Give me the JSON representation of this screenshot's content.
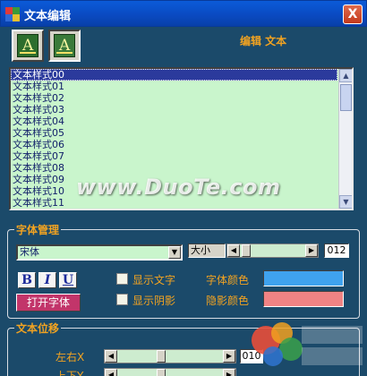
{
  "window": {
    "title": "文本编辑",
    "close_glyph": "X"
  },
  "toolbar": {
    "btn1_icon": "text-style-icon",
    "btn2_icon": "text-style-pressed-icon",
    "glyph": "A"
  },
  "header": {
    "label": "编辑 文本"
  },
  "text_styles": {
    "items": [
      "文本样式00",
      "文本样式01",
      "文本样式02",
      "文本样式03",
      "文本样式04",
      "文本样式05",
      "文本样式06",
      "文本样式07",
      "文本样式08",
      "文本样式09",
      "文本样式10",
      "文本样式11"
    ],
    "selected_index": 0
  },
  "watermark": {
    "text": "www.DuoTe.com"
  },
  "font_group": {
    "title": "字体管理",
    "font_name": "宋体",
    "size_label": "大小",
    "size_value": "012",
    "bold": "B",
    "italic": "I",
    "underline": "U",
    "open_font": "打开字体",
    "show_text": "显示文字",
    "show_shadow": "显示阴影",
    "font_color_label": "字体颜色",
    "shadow_color_label": "隐影颜色",
    "font_color": "#3fa2ee",
    "shadow_color": "#f08384"
  },
  "offset_group": {
    "title": "文本位移",
    "lr_label": "左右X",
    "lr_value": "010",
    "ud_label": "上下Y"
  },
  "colors": {
    "title_bar": "#0a49c0",
    "background": "#1b4a6a",
    "accent": "#f2a321",
    "list_bg": "#c9f5cc",
    "selection": "#2b3a9c"
  }
}
